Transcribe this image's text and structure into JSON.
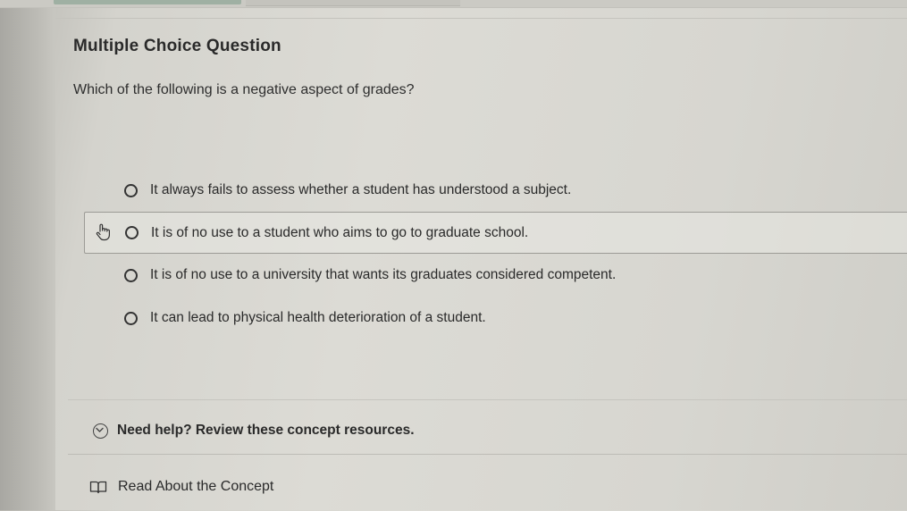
{
  "question": {
    "title": "Multiple Choice Question",
    "prompt": "Which of the following is a negative aspect of grades?",
    "options": [
      {
        "label": "It always fails to assess whether a student has understood a subject."
      },
      {
        "label": "It is of no use to a student who aims to go to graduate school."
      },
      {
        "label": "It is of no use to a university that wants its graduates considered competent."
      },
      {
        "label": "It can lead to physical health deterioration of a student."
      }
    ]
  },
  "help": {
    "label": "Need help? Review these concept resources.",
    "icon": "chevron-down-circle-icon"
  },
  "resources": [
    {
      "label": "Read About the Concept",
      "icon": "book-icon"
    }
  ],
  "colors": {
    "background": "#dcdbd5",
    "text": "#2a2a2a",
    "hover_border": "#9c9b96"
  }
}
